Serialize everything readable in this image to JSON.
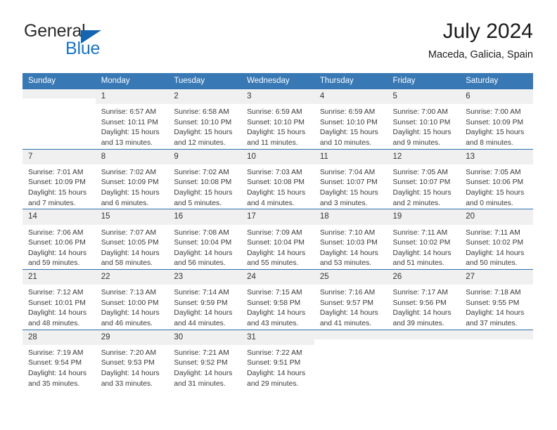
{
  "logo": {
    "text_top": "General",
    "text_bottom": "Blue",
    "triangle_color": "#1565b0",
    "blue_color": "#1874c4"
  },
  "header": {
    "title": "July 2024",
    "subtitle": "Maceda, Galicia, Spain"
  },
  "theme": {
    "header_bg": "#3878b4",
    "row_border": "#2f6fae",
    "daynum_bg": "#f0f0f0"
  },
  "calendar": {
    "weekday_headers": [
      "Sunday",
      "Monday",
      "Tuesday",
      "Wednesday",
      "Thursday",
      "Friday",
      "Saturday"
    ],
    "weeks": [
      [
        {
          "day": "",
          "sunrise": "",
          "sunset": "",
          "daylight_1": "",
          "daylight_2": ""
        },
        {
          "day": "1",
          "sunrise": "Sunrise: 6:57 AM",
          "sunset": "Sunset: 10:11 PM",
          "daylight_1": "Daylight: 15 hours",
          "daylight_2": "and 13 minutes."
        },
        {
          "day": "2",
          "sunrise": "Sunrise: 6:58 AM",
          "sunset": "Sunset: 10:10 PM",
          "daylight_1": "Daylight: 15 hours",
          "daylight_2": "and 12 minutes."
        },
        {
          "day": "3",
          "sunrise": "Sunrise: 6:59 AM",
          "sunset": "Sunset: 10:10 PM",
          "daylight_1": "Daylight: 15 hours",
          "daylight_2": "and 11 minutes."
        },
        {
          "day": "4",
          "sunrise": "Sunrise: 6:59 AM",
          "sunset": "Sunset: 10:10 PM",
          "daylight_1": "Daylight: 15 hours",
          "daylight_2": "and 10 minutes."
        },
        {
          "day": "5",
          "sunrise": "Sunrise: 7:00 AM",
          "sunset": "Sunset: 10:10 PM",
          "daylight_1": "Daylight: 15 hours",
          "daylight_2": "and 9 minutes."
        },
        {
          "day": "6",
          "sunrise": "Sunrise: 7:00 AM",
          "sunset": "Sunset: 10:09 PM",
          "daylight_1": "Daylight: 15 hours",
          "daylight_2": "and 8 minutes."
        }
      ],
      [
        {
          "day": "7",
          "sunrise": "Sunrise: 7:01 AM",
          "sunset": "Sunset: 10:09 PM",
          "daylight_1": "Daylight: 15 hours",
          "daylight_2": "and 7 minutes."
        },
        {
          "day": "8",
          "sunrise": "Sunrise: 7:02 AM",
          "sunset": "Sunset: 10:09 PM",
          "daylight_1": "Daylight: 15 hours",
          "daylight_2": "and 6 minutes."
        },
        {
          "day": "9",
          "sunrise": "Sunrise: 7:02 AM",
          "sunset": "Sunset: 10:08 PM",
          "daylight_1": "Daylight: 15 hours",
          "daylight_2": "and 5 minutes."
        },
        {
          "day": "10",
          "sunrise": "Sunrise: 7:03 AM",
          "sunset": "Sunset: 10:08 PM",
          "daylight_1": "Daylight: 15 hours",
          "daylight_2": "and 4 minutes."
        },
        {
          "day": "11",
          "sunrise": "Sunrise: 7:04 AM",
          "sunset": "Sunset: 10:07 PM",
          "daylight_1": "Daylight: 15 hours",
          "daylight_2": "and 3 minutes."
        },
        {
          "day": "12",
          "sunrise": "Sunrise: 7:05 AM",
          "sunset": "Sunset: 10:07 PM",
          "daylight_1": "Daylight: 15 hours",
          "daylight_2": "and 2 minutes."
        },
        {
          "day": "13",
          "sunrise": "Sunrise: 7:05 AM",
          "sunset": "Sunset: 10:06 PM",
          "daylight_1": "Daylight: 15 hours",
          "daylight_2": "and 0 minutes."
        }
      ],
      [
        {
          "day": "14",
          "sunrise": "Sunrise: 7:06 AM",
          "sunset": "Sunset: 10:06 PM",
          "daylight_1": "Daylight: 14 hours",
          "daylight_2": "and 59 minutes."
        },
        {
          "day": "15",
          "sunrise": "Sunrise: 7:07 AM",
          "sunset": "Sunset: 10:05 PM",
          "daylight_1": "Daylight: 14 hours",
          "daylight_2": "and 58 minutes."
        },
        {
          "day": "16",
          "sunrise": "Sunrise: 7:08 AM",
          "sunset": "Sunset: 10:04 PM",
          "daylight_1": "Daylight: 14 hours",
          "daylight_2": "and 56 minutes."
        },
        {
          "day": "17",
          "sunrise": "Sunrise: 7:09 AM",
          "sunset": "Sunset: 10:04 PM",
          "daylight_1": "Daylight: 14 hours",
          "daylight_2": "and 55 minutes."
        },
        {
          "day": "18",
          "sunrise": "Sunrise: 7:10 AM",
          "sunset": "Sunset: 10:03 PM",
          "daylight_1": "Daylight: 14 hours",
          "daylight_2": "and 53 minutes."
        },
        {
          "day": "19",
          "sunrise": "Sunrise: 7:11 AM",
          "sunset": "Sunset: 10:02 PM",
          "daylight_1": "Daylight: 14 hours",
          "daylight_2": "and 51 minutes."
        },
        {
          "day": "20",
          "sunrise": "Sunrise: 7:11 AM",
          "sunset": "Sunset: 10:02 PM",
          "daylight_1": "Daylight: 14 hours",
          "daylight_2": "and 50 minutes."
        }
      ],
      [
        {
          "day": "21",
          "sunrise": "Sunrise: 7:12 AM",
          "sunset": "Sunset: 10:01 PM",
          "daylight_1": "Daylight: 14 hours",
          "daylight_2": "and 48 minutes."
        },
        {
          "day": "22",
          "sunrise": "Sunrise: 7:13 AM",
          "sunset": "Sunset: 10:00 PM",
          "daylight_1": "Daylight: 14 hours",
          "daylight_2": "and 46 minutes."
        },
        {
          "day": "23",
          "sunrise": "Sunrise: 7:14 AM",
          "sunset": "Sunset: 9:59 PM",
          "daylight_1": "Daylight: 14 hours",
          "daylight_2": "and 44 minutes."
        },
        {
          "day": "24",
          "sunrise": "Sunrise: 7:15 AM",
          "sunset": "Sunset: 9:58 PM",
          "daylight_1": "Daylight: 14 hours",
          "daylight_2": "and 43 minutes."
        },
        {
          "day": "25",
          "sunrise": "Sunrise: 7:16 AM",
          "sunset": "Sunset: 9:57 PM",
          "daylight_1": "Daylight: 14 hours",
          "daylight_2": "and 41 minutes."
        },
        {
          "day": "26",
          "sunrise": "Sunrise: 7:17 AM",
          "sunset": "Sunset: 9:56 PM",
          "daylight_1": "Daylight: 14 hours",
          "daylight_2": "and 39 minutes."
        },
        {
          "day": "27",
          "sunrise": "Sunrise: 7:18 AM",
          "sunset": "Sunset: 9:55 PM",
          "daylight_1": "Daylight: 14 hours",
          "daylight_2": "and 37 minutes."
        }
      ],
      [
        {
          "day": "28",
          "sunrise": "Sunrise: 7:19 AM",
          "sunset": "Sunset: 9:54 PM",
          "daylight_1": "Daylight: 14 hours",
          "daylight_2": "and 35 minutes."
        },
        {
          "day": "29",
          "sunrise": "Sunrise: 7:20 AM",
          "sunset": "Sunset: 9:53 PM",
          "daylight_1": "Daylight: 14 hours",
          "daylight_2": "and 33 minutes."
        },
        {
          "day": "30",
          "sunrise": "Sunrise: 7:21 AM",
          "sunset": "Sunset: 9:52 PM",
          "daylight_1": "Daylight: 14 hours",
          "daylight_2": "and 31 minutes."
        },
        {
          "day": "31",
          "sunrise": "Sunrise: 7:22 AM",
          "sunset": "Sunset: 9:51 PM",
          "daylight_1": "Daylight: 14 hours",
          "daylight_2": "and 29 minutes."
        },
        {
          "day": "",
          "sunrise": "",
          "sunset": "",
          "daylight_1": "",
          "daylight_2": ""
        },
        {
          "day": "",
          "sunrise": "",
          "sunset": "",
          "daylight_1": "",
          "daylight_2": ""
        },
        {
          "day": "",
          "sunrise": "",
          "sunset": "",
          "daylight_1": "",
          "daylight_2": ""
        }
      ]
    ]
  }
}
